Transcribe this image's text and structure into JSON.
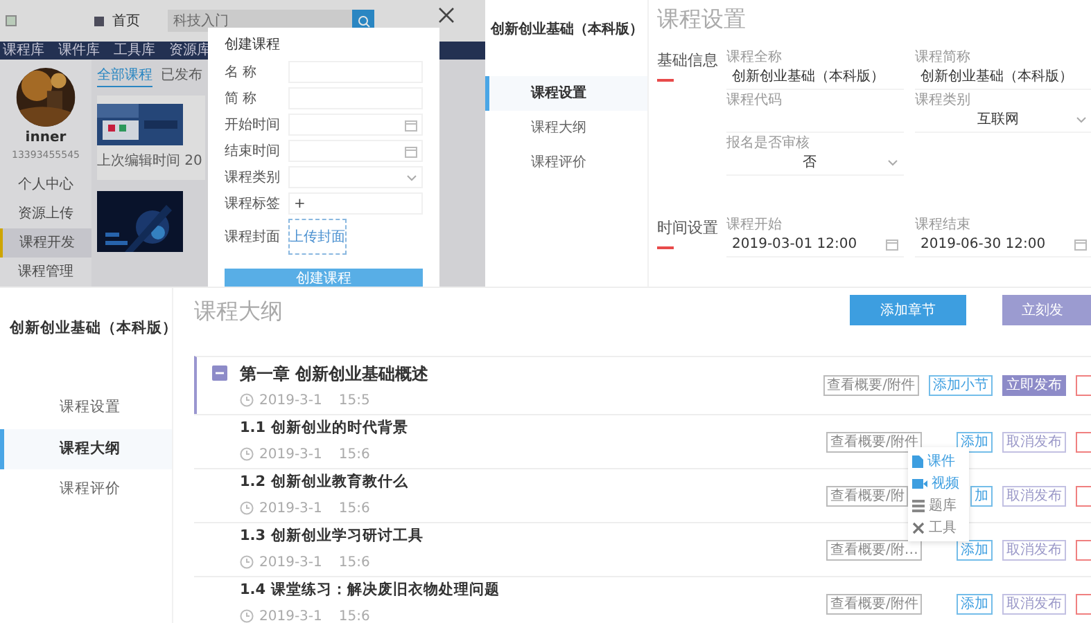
{
  "portal_screen": {
    "home": "首页",
    "search": {
      "placeholder": "科技入门"
    },
    "nav": [
      "课程库",
      "课件库",
      "工具库",
      "资源库"
    ],
    "profile": {
      "name": "inner",
      "phone": "13393455545"
    },
    "menu": [
      {
        "label": "个人中心",
        "selected": false
      },
      {
        "label": "资源上传",
        "selected": false
      },
      {
        "label": "课程开发",
        "selected": true
      },
      {
        "label": "课程管理",
        "selected": false
      }
    ],
    "tabs": [
      {
        "label": "全部课程",
        "selected": true
      },
      {
        "label": "已发布",
        "selected": false
      }
    ],
    "card_caption": "上次编辑时间 20",
    "dialog": {
      "title": "创建课程",
      "fields": [
        {
          "label": "名 称",
          "kind": "text"
        },
        {
          "label": "简 称",
          "kind": "text"
        },
        {
          "label": "开始时间",
          "kind": "date"
        },
        {
          "label": "结束时间",
          "kind": "date"
        },
        {
          "label": "课程类别",
          "kind": "select"
        },
        {
          "label": "课程标签",
          "kind": "tag",
          "value": "+"
        },
        {
          "label": "课程封面",
          "kind": "upload",
          "value": "上传封面"
        }
      ],
      "submit": "创建课程"
    }
  },
  "settings_screen": {
    "course_title": "创新创业基础（本科版）",
    "nav": [
      {
        "label": "课程设置",
        "selected": true
      },
      {
        "label": "课程大纲",
        "selected": false
      },
      {
        "label": "课程评价",
        "selected": false
      }
    ],
    "heading": "课程设置",
    "sections": [
      {
        "title": "基础信息",
        "fields": [
          {
            "label": "课程全称",
            "kind": "text",
            "value": "创新创业基础（本科版）"
          },
          {
            "label": "课程简称",
            "kind": "text",
            "value": "创新创业基础（本科版）"
          },
          {
            "label": "课程代码",
            "kind": "text"
          },
          {
            "label": "课程类别",
            "kind": "select",
            "value": "互联网"
          },
          {
            "label": "报名是否审核",
            "kind": "select",
            "value": "否"
          }
        ]
      },
      {
        "title": "时间设置",
        "fields": [
          {
            "label": "课程开始",
            "kind": "date",
            "value": "2019-03-01 12:00"
          },
          {
            "label": "课程结束",
            "kind": "date",
            "value": "2019-06-30 12:00"
          }
        ]
      }
    ]
  },
  "outline_screen": {
    "course_title": "创新创业基础（本科版）",
    "nav": [
      {
        "label": "课程设置",
        "selected": false
      },
      {
        "label": "课程大纲",
        "selected": true
      },
      {
        "label": "课程评价",
        "selected": false
      }
    ],
    "heading": "课程大纲",
    "actions": [
      {
        "label": "添加章节",
        "kind": "primary"
      },
      {
        "label": "立刻发",
        "kind": "publish"
      }
    ],
    "chapter": {
      "title": "第一章 创新创业基础概述",
      "expanded": true,
      "date": "2019-3-1",
      "time": "15:5",
      "buttons": [
        {
          "label": "查看概要/附件",
          "kind": "view"
        },
        {
          "label": "添加小节",
          "kind": "add"
        },
        {
          "label": "立即发布",
          "kind": "publish"
        },
        {
          "kind": "delete"
        }
      ]
    },
    "sections": [
      {
        "title": "1.1 创新创业的时代背景",
        "date": "2019-3-1",
        "time": "15:6",
        "buttons": [
          {
            "label": "查看概要/附件",
            "kind": "view"
          },
          {
            "label": "添加",
            "kind": "add"
          },
          {
            "label": "取消发布",
            "kind": "cancel"
          },
          {
            "kind": "delete"
          }
        ]
      },
      {
        "title": "1.2 创新创业教育教什么",
        "date": "2019-3-1",
        "time": "15:6",
        "buttons": [
          {
            "label": "查看概要/附",
            "kind": "view"
          },
          {
            "label": "加",
            "kind": "add"
          },
          {
            "label": "取消发布",
            "kind": "cancel"
          },
          {
            "kind": "delete"
          }
        ]
      },
      {
        "title": "1.3 创新创业学习研讨工具",
        "date": "2019-3-1",
        "time": "15:6",
        "buttons": [
          {
            "label": "查看概要/附…",
            "kind": "view"
          },
          {
            "label": "添加",
            "kind": "add"
          },
          {
            "label": "取消发布",
            "kind": "cancel"
          },
          {
            "kind": "delete"
          }
        ]
      },
      {
        "title": "1.4 课堂练习：解决废旧衣物处理问题",
        "date": "2019-3-1",
        "time": "15:6",
        "buttons": [
          {
            "label": "查看概要/附件",
            "kind": "view"
          },
          {
            "label": "添加",
            "kind": "add"
          },
          {
            "label": "取消发布",
            "kind": "cancel"
          },
          {
            "kind": "delete"
          }
        ]
      }
    ],
    "add_menu": [
      {
        "label": "课件",
        "kind": "file"
      },
      {
        "label": "视频",
        "kind": "video"
      },
      {
        "label": "题库",
        "kind": "bank"
      },
      {
        "label": "工具",
        "kind": "tool"
      }
    ]
  }
}
